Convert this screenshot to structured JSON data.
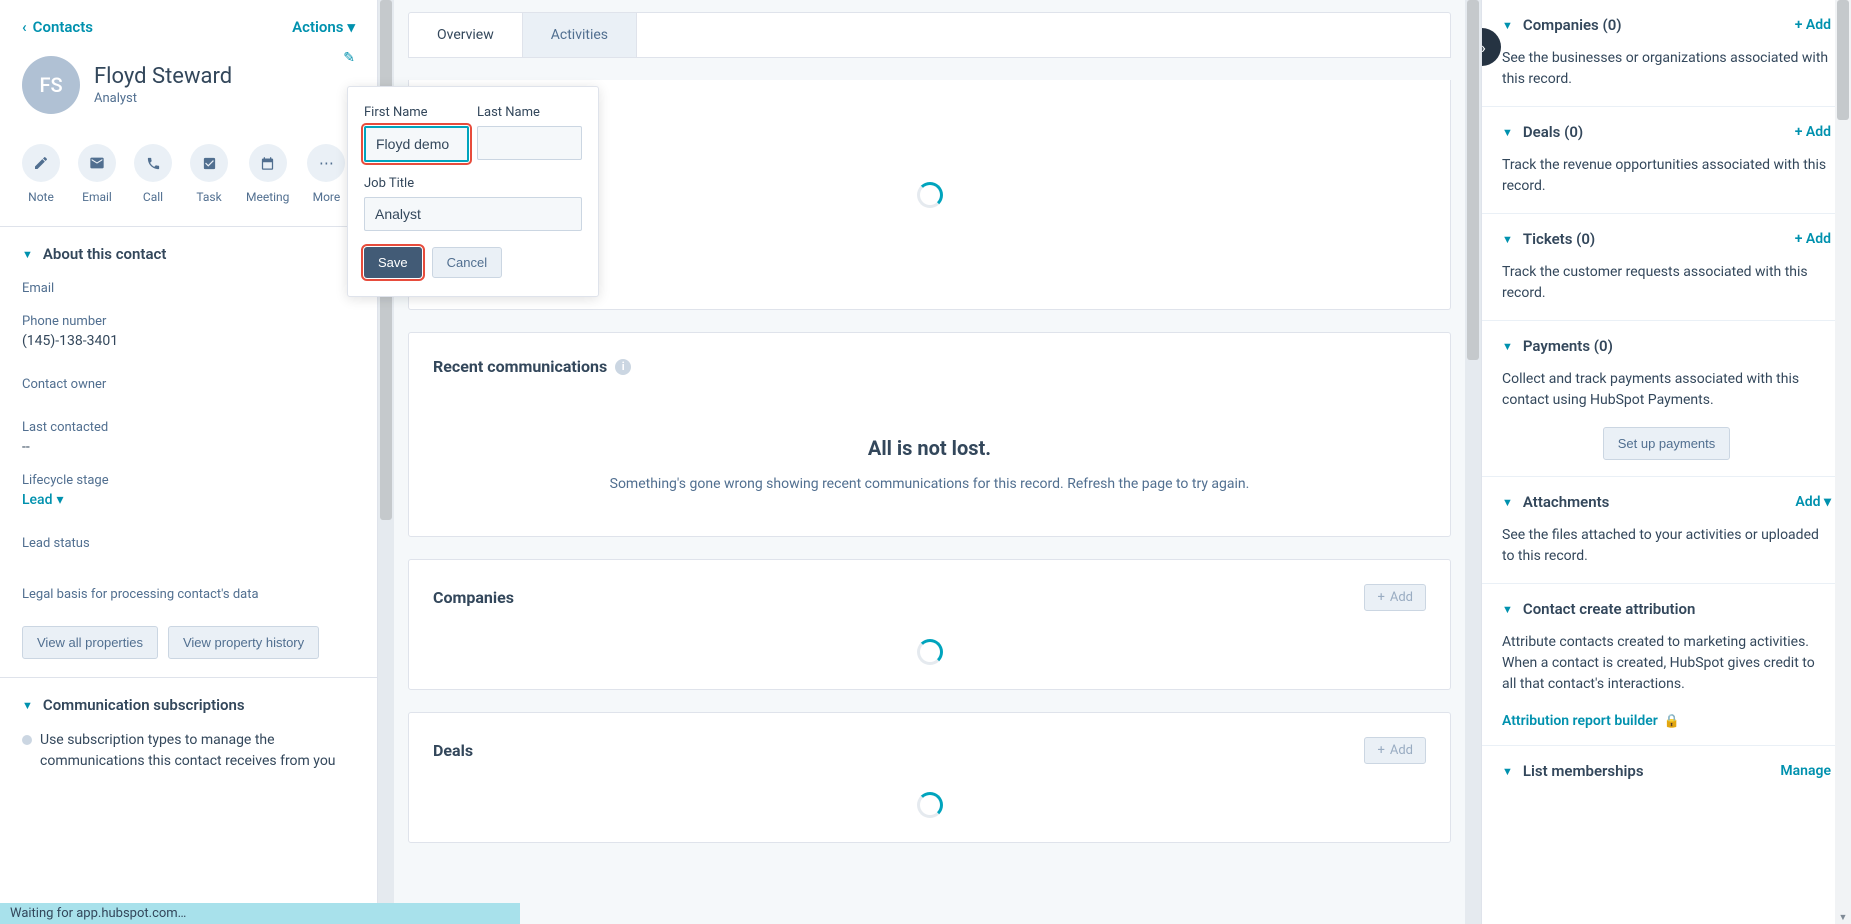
{
  "left": {
    "back": "Contacts",
    "actions": "Actions",
    "avatar_initials": "FS",
    "name": "Floyd Steward",
    "title": "Analyst",
    "actions_row": {
      "note": "Note",
      "email": "Email",
      "call": "Call",
      "task": "Task",
      "meeting": "Meeting",
      "more": "More"
    },
    "about": {
      "heading": "About this contact",
      "email_label": "Email",
      "phone_label": "Phone number",
      "phone_value": "(145)-138-3401",
      "owner_label": "Contact owner",
      "last_contacted_label": "Last contacted",
      "last_contacted_value": "--",
      "lifecycle_label": "Lifecycle stage",
      "lifecycle_value": "Lead",
      "lead_status_label": "Lead status",
      "legal_basis_label": "Legal basis for processing contact's data",
      "view_all": "View all properties",
      "view_history": "View property history"
    },
    "subs": {
      "heading": "Communication subscriptions",
      "desc": "Use subscription types to manage the communications this contact receives from you"
    }
  },
  "popover": {
    "first_label": "First Name",
    "first_value": "Floyd demo",
    "last_label": "Last Name",
    "last_value": "",
    "job_label": "Job Title",
    "job_value": "Analyst",
    "save": "Save",
    "cancel": "Cancel"
  },
  "mid": {
    "tabs": {
      "overview": "Overview",
      "activities": "Activities"
    },
    "recent": {
      "title": "Recent communications",
      "empty_title": "All is not lost.",
      "empty_msg": "Something's gone wrong showing recent communications for this record. Refresh the page to try again."
    },
    "companies": {
      "title": "Companies",
      "add": "Add"
    },
    "deals": {
      "title": "Deals",
      "add": "Add"
    }
  },
  "right": {
    "companies": {
      "title": "Companies (0)",
      "add": "+ Add",
      "desc": "See the businesses or organizations associated with this record."
    },
    "deals": {
      "title": "Deals (0)",
      "add": "+ Add",
      "desc": "Track the revenue opportunities associated with this record."
    },
    "tickets": {
      "title": "Tickets (0)",
      "add": "+ Add",
      "desc": "Track the customer requests associated with this record."
    },
    "payments": {
      "title": "Payments (0)",
      "desc": "Collect and track payments associated with this contact using HubSpot Payments.",
      "btn": "Set up payments"
    },
    "attachments": {
      "title": "Attachments",
      "add": "Add",
      "desc": "See the files attached to your activities or uploaded to this record."
    },
    "attribution": {
      "title": "Contact create attribution",
      "desc": "Attribute contacts created to marketing activities. When a contact is created, HubSpot gives credit to all that contact's interactions.",
      "link": "Attribution report builder"
    },
    "lists": {
      "title": "List memberships",
      "manage": "Manage"
    }
  },
  "status": "Waiting for app.hubspot.com…"
}
